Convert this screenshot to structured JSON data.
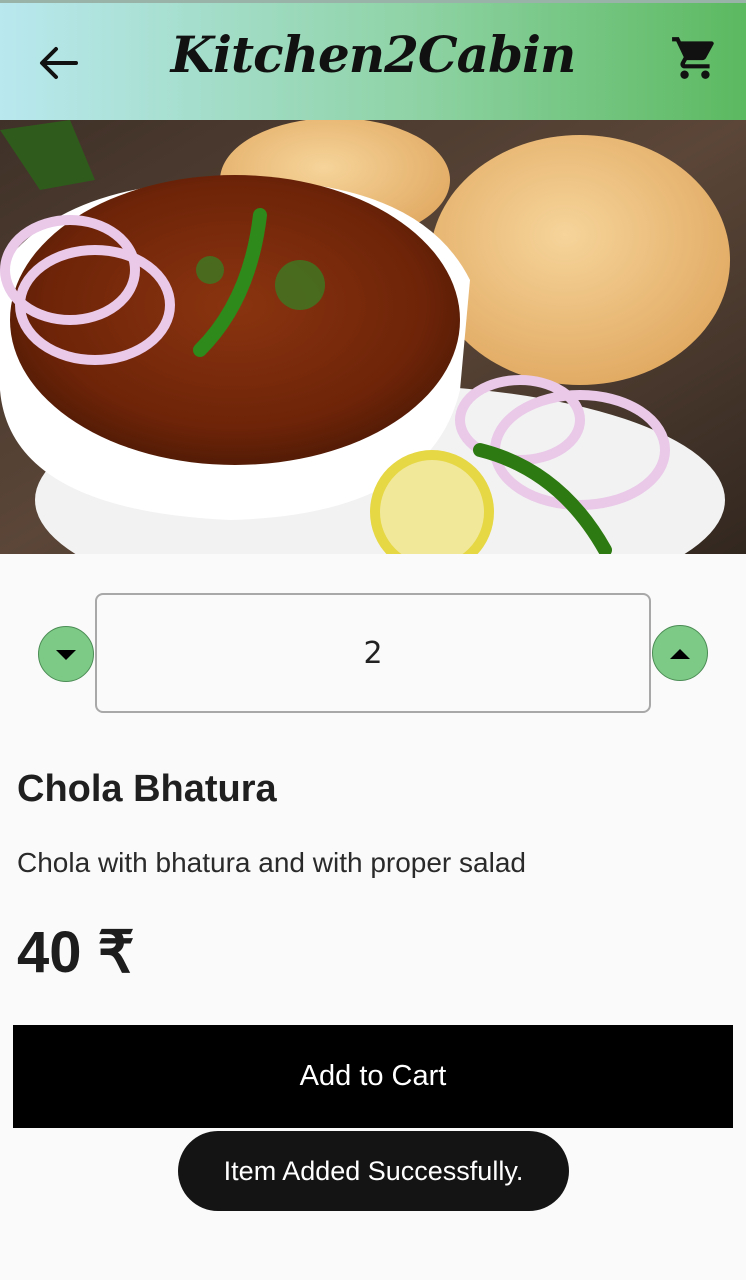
{
  "appbar": {
    "title": "Kitchen2Cabin",
    "back_icon": "arrow-left-icon",
    "cart_icon": "shopping-cart-icon"
  },
  "colors": {
    "appbar_gradient_start": "#b9e8ef",
    "appbar_gradient_end": "#5cb960",
    "stepper_green": "#7dca86",
    "button_bg": "#000000",
    "toast_bg": "#141414"
  },
  "product": {
    "image_alt": "Chola Bhatura dish photo",
    "quantity": "2",
    "name": "Chola Bhatura",
    "description": "Chola with bhatura and with proper salad",
    "price": "40 ₹"
  },
  "stepper": {
    "decrement_icon": "caret-down-icon",
    "increment_icon": "caret-up-icon"
  },
  "actions": {
    "add_to_cart_label": "Add to Cart"
  },
  "toast": {
    "message": "Item Added Successfully."
  }
}
